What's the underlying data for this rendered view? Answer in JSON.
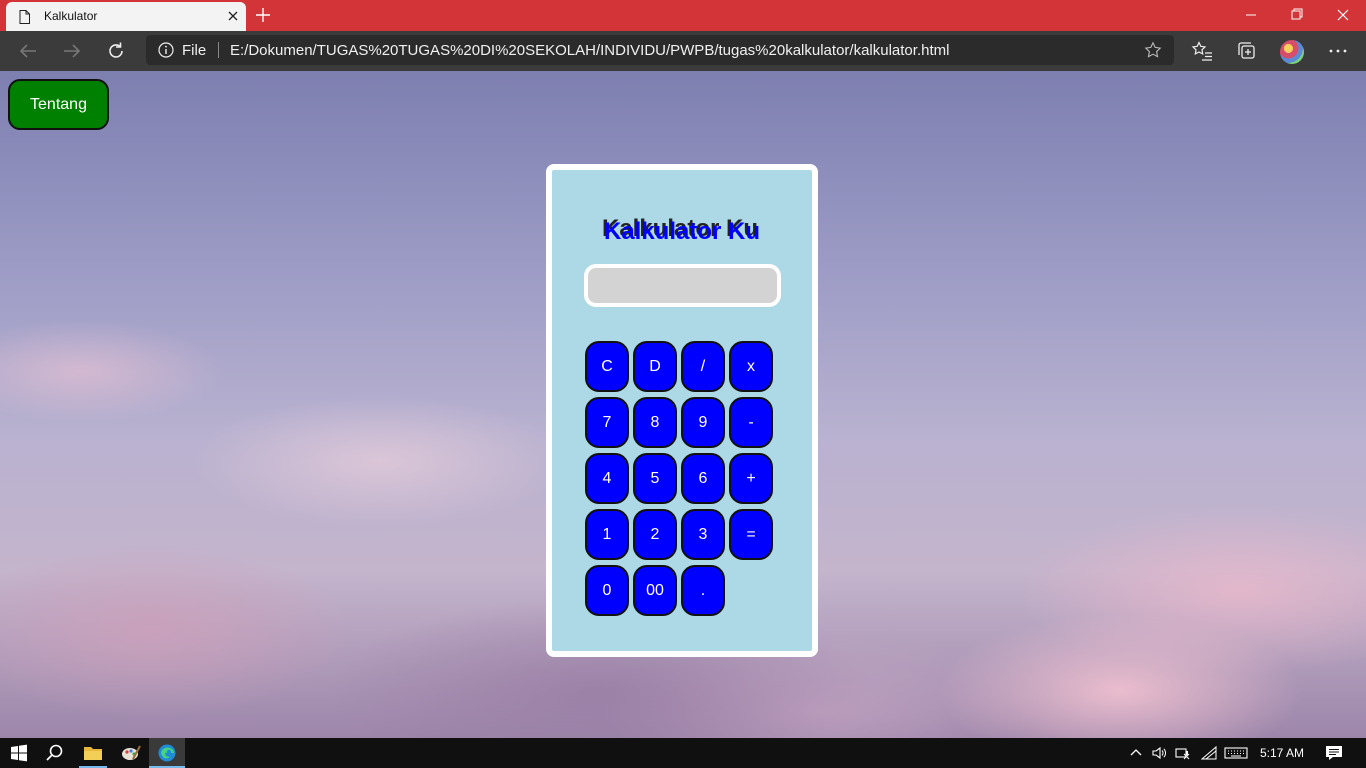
{
  "browser": {
    "tab_title": "Kalkulator",
    "url_scheme": "File",
    "url": "E:/Dokumen/TUGAS%20TUGAS%20DI%20SEKOLAH/INDIVIDU/PWPB/tugas%20kalkulator/kalkulator.html",
    "accent_color": "#d23437"
  },
  "page": {
    "about_button": "Tentang",
    "calculator": {
      "title": "Kalkulator Ku",
      "display_value": "",
      "keys": [
        "C",
        "D",
        "/",
        "x",
        "7",
        "8",
        "9",
        "-",
        "4",
        "5",
        "6",
        "+",
        "1",
        "2",
        "3",
        "=",
        "0",
        "00",
        "."
      ]
    },
    "colors": {
      "about_button_bg": "#008000",
      "calculator_bg": "#add8e6",
      "key_bg": "#0000ff",
      "display_bg": "#d3d3d3"
    }
  },
  "taskbar": {
    "clock": "5:17 AM",
    "icons": [
      "windows-start-icon",
      "search-icon",
      "file-explorer-icon",
      "paint-icon",
      "edge-icon"
    ]
  }
}
